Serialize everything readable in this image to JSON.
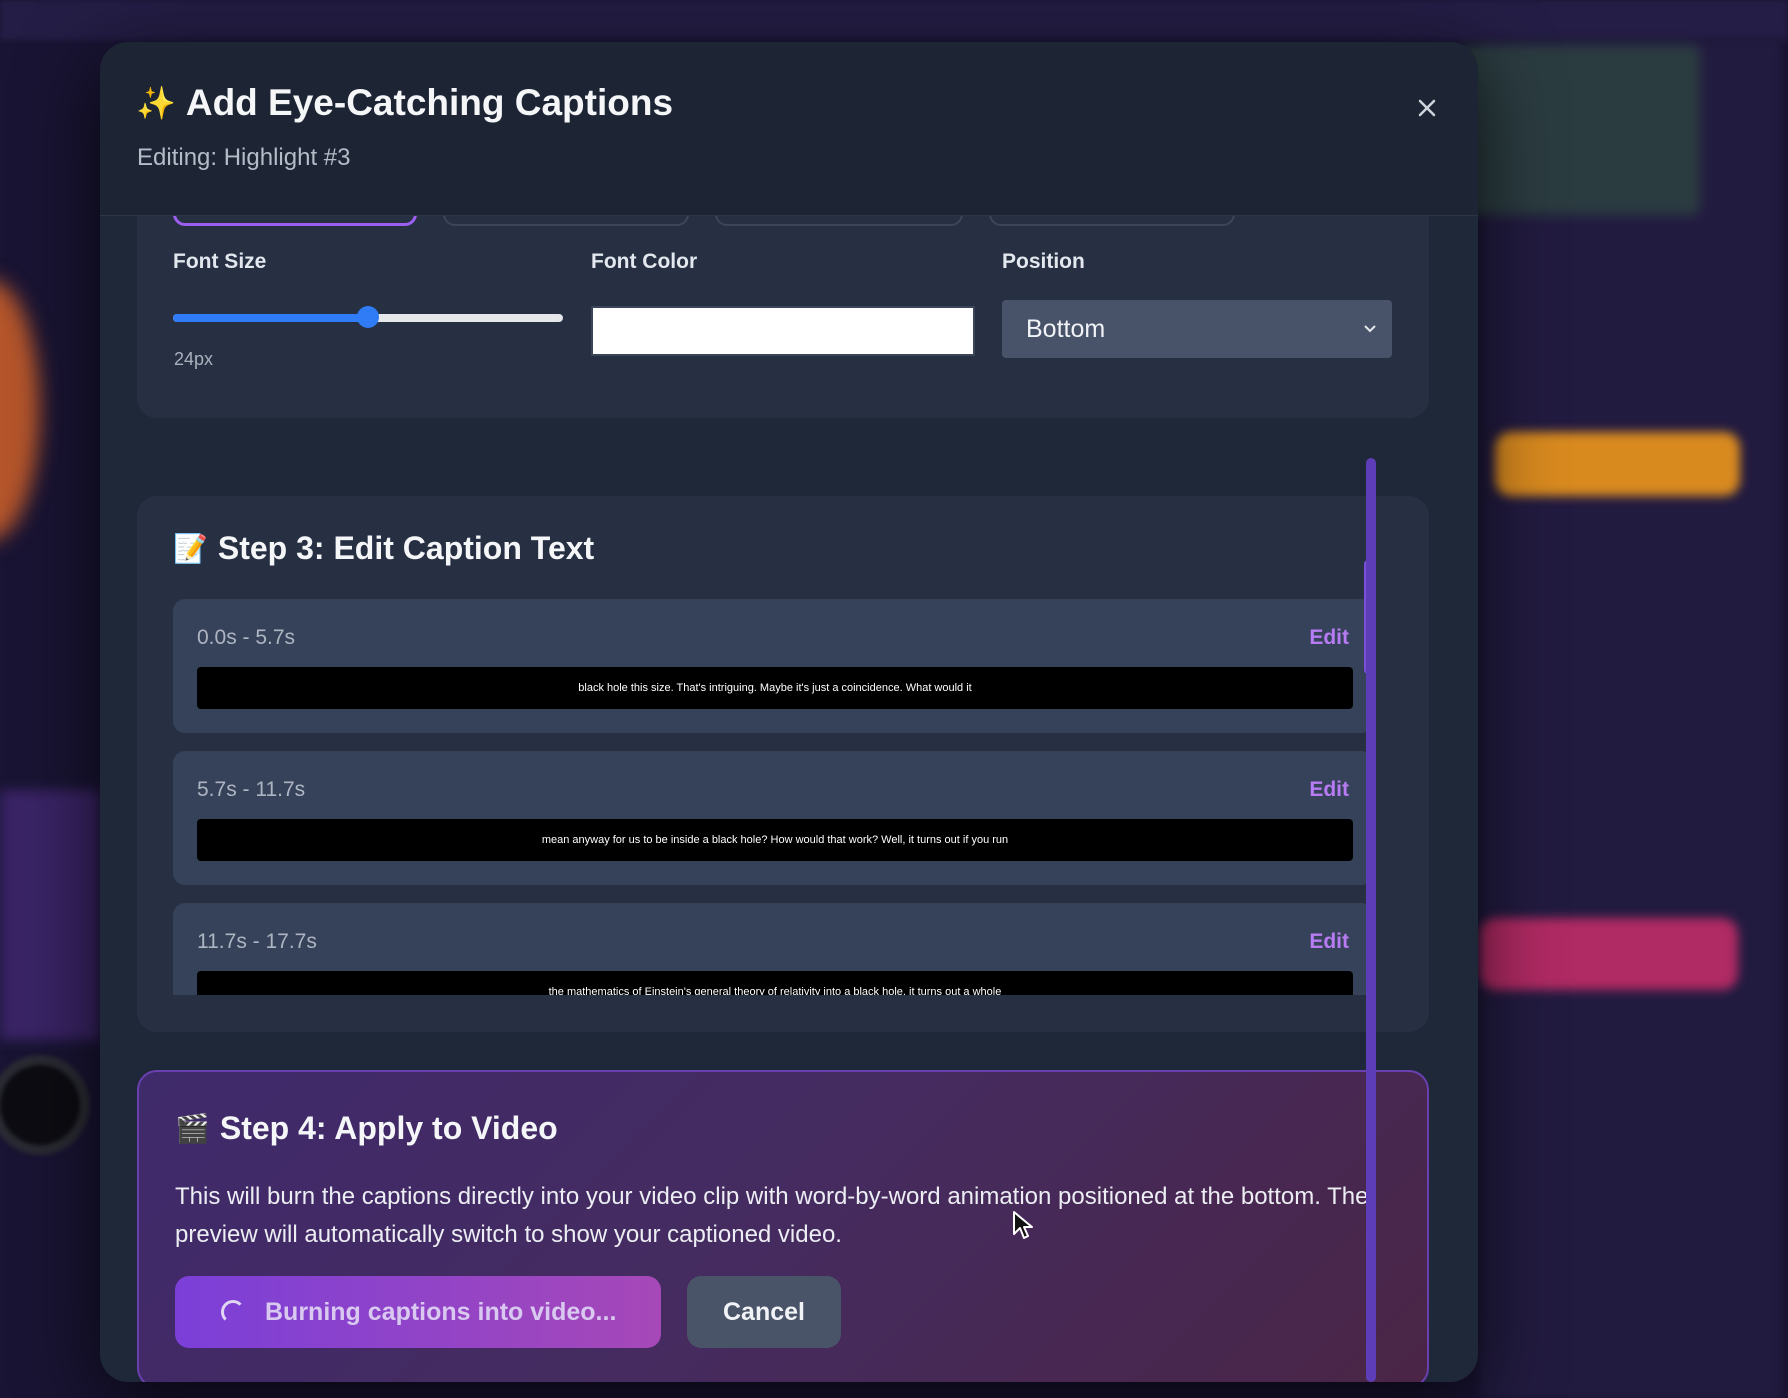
{
  "modal": {
    "title": "Add Eye-Catching Captions",
    "title_icon": "sparkles-icon",
    "subtitle": "Editing: Highlight #3"
  },
  "style_controls": {
    "font_size_label": "Font Size",
    "font_size_value": "24px",
    "font_size_slider_fraction": 0.5,
    "font_color_label": "Font Color",
    "font_color_value": "#ffffff",
    "position_label": "Position",
    "position_value": "Bottom"
  },
  "step3": {
    "title": "Step 3: Edit Caption Text",
    "icon": "memo-icon",
    "captions": [
      {
        "time": "0.0s - 5.7s",
        "edit_label": "Edit",
        "text": "black hole this size. That's intriguing. Maybe it's just a coincidence. What would it"
      },
      {
        "time": "5.7s - 11.7s",
        "edit_label": "Edit",
        "text": "mean anyway for us to be inside a black hole? How would that work? Well, it turns out if you run"
      },
      {
        "time": "11.7s - 17.7s",
        "edit_label": "Edit",
        "text": "the mathematics of Einstein's general theory of relativity into a black hole, it turns out a whole"
      }
    ]
  },
  "step4": {
    "title": "Step 4: Apply to Video",
    "icon": "clapper-board-icon",
    "description": "This will burn the captions directly into your video clip with word-by-word animation positioned at the bottom. The preview will automatically switch to show your captioned video.",
    "primary_button": "Burning captions into video...",
    "cancel_button": "Cancel"
  },
  "colors": {
    "accent_purple": "#9b5ff0",
    "edit_link": "#b77cf4",
    "slider_blue": "#2f7cf6"
  }
}
